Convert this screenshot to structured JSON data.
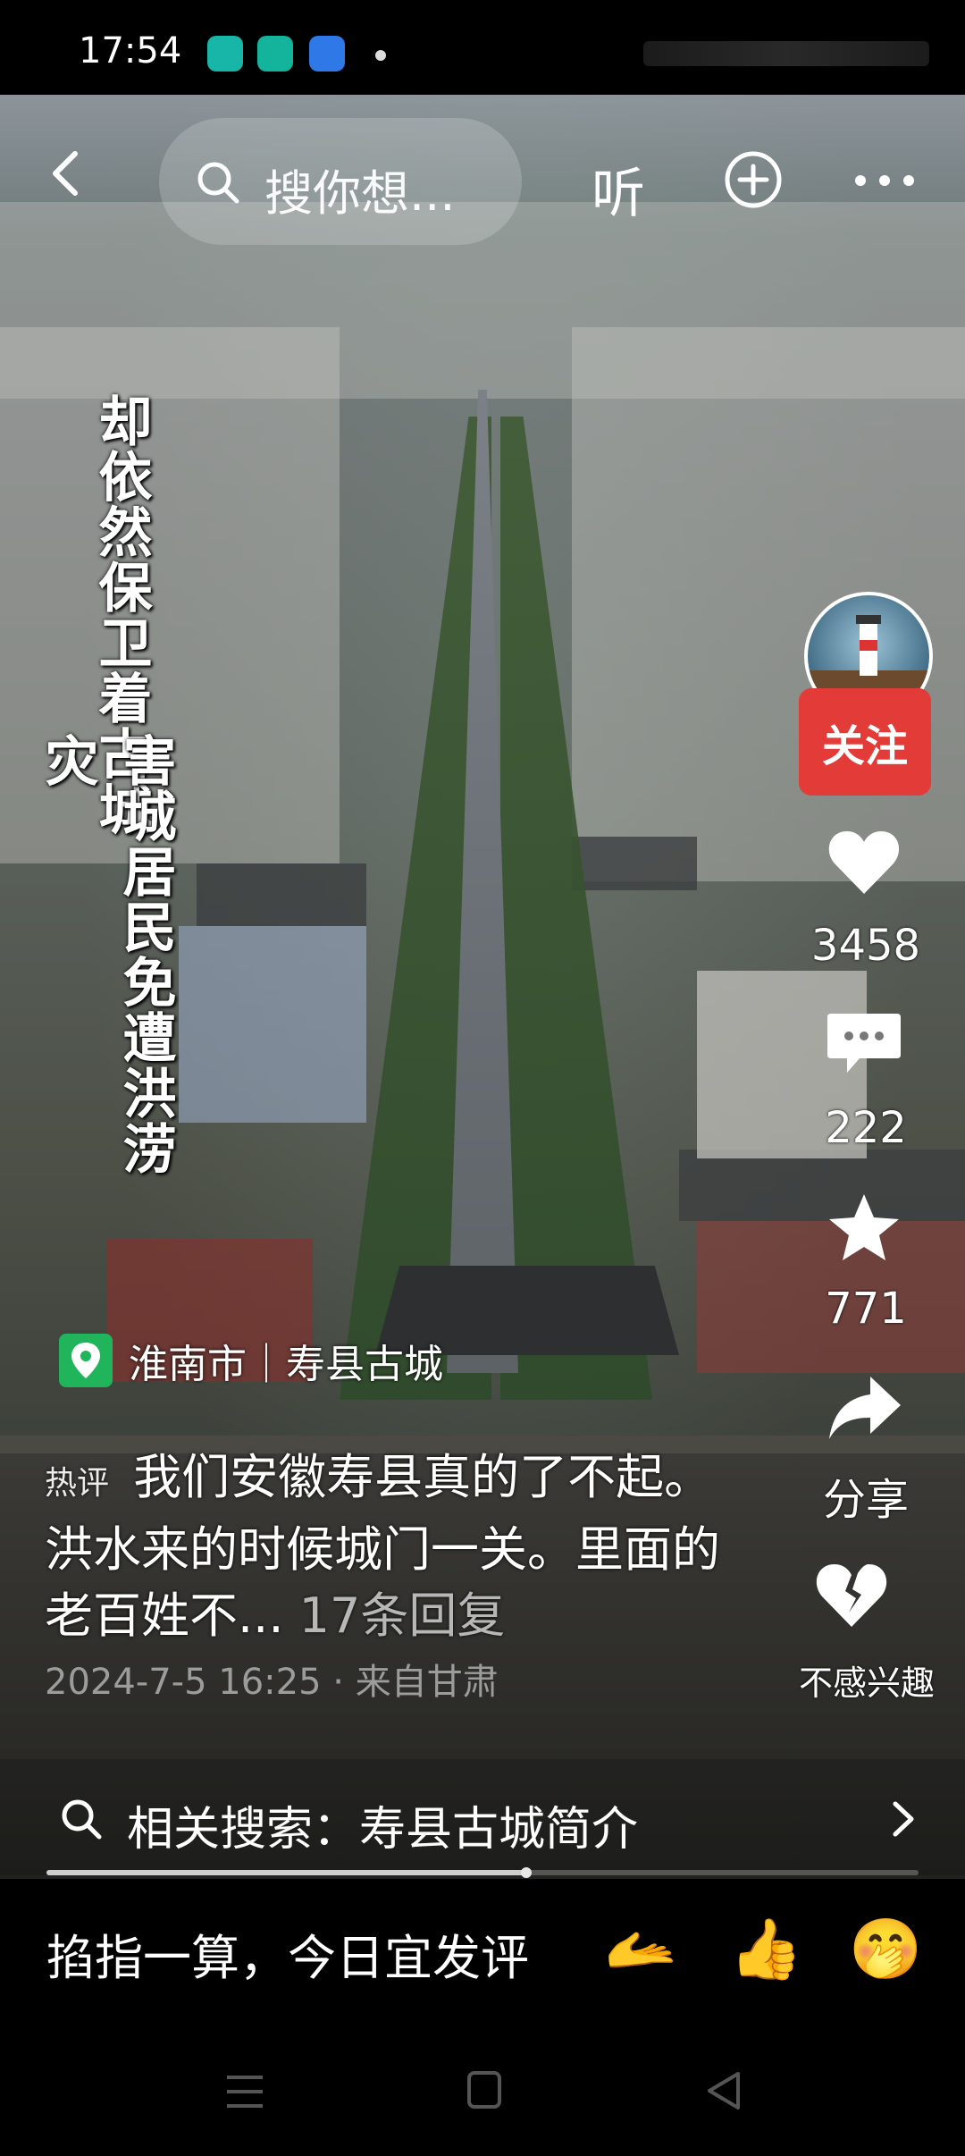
{
  "status_bar": {
    "time": "17:54"
  },
  "top_nav": {
    "search_placeholder": "搜你想...",
    "listen_label": "听"
  },
  "video": {
    "vertical_caption_cols": [
      "却依然保卫着古城",
      "害城居民免遭洪涝灾"
    ]
  },
  "right_rail": {
    "follow_label": "关注",
    "likes": "3458",
    "comments": "222",
    "favorites": "771",
    "share_label": "分享",
    "not_interested_label": "不感兴趣"
  },
  "location": {
    "label": "淮南市｜寿县古城"
  },
  "hot_comment": {
    "tag": "热评",
    "text": "我们安徽寿县真的了不起。洪水来的时候城门一关。里面的老百姓不...",
    "replies": "17条回复",
    "meta": "2024-7-5 16:25 · 来自甘肃"
  },
  "related_search": {
    "label": "相关搜索：寿县古城简介"
  },
  "playback": {
    "progress": 0.55
  },
  "comment_bar": {
    "prompt": "掐指一算，今日宜发评",
    "emojis": [
      "🫴",
      "👍",
      "🤭"
    ]
  },
  "colors": {
    "follow_red": "#e23b38",
    "location_green": "#20b45b"
  }
}
